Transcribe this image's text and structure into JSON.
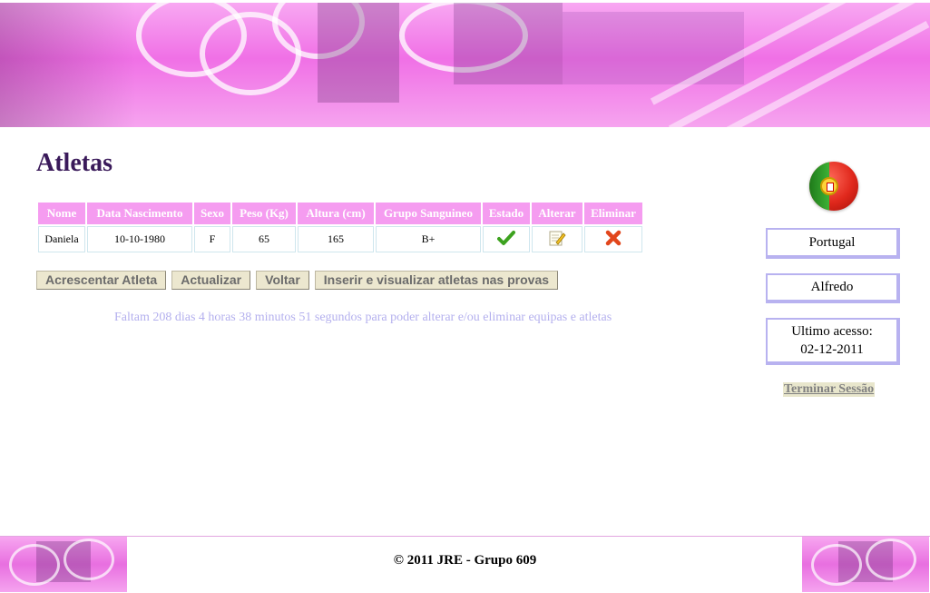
{
  "page": {
    "title": "Atletas"
  },
  "table": {
    "headers": [
      "Nome",
      "Data Nascimento",
      "Sexo",
      "Peso (Kg)",
      "Altura (cm)",
      "Grupo Sanguineo",
      "Estado",
      "Alterar",
      "Eliminar"
    ],
    "rows": [
      {
        "nome": "Daniela",
        "data_nascimento": "10-10-1980",
        "sexo": "F",
        "peso": "65",
        "altura": "165",
        "grupo_sanguineo": "B+",
        "estado_icon": "checkmark-icon",
        "alterar_icon": "edit-icon",
        "eliminar_icon": "delete-icon"
      }
    ]
  },
  "buttons": {
    "add": "Acrescentar Atleta",
    "refresh": "Actualizar",
    "back": "Voltar",
    "insert": "Inserir e visualizar atletas nas provas"
  },
  "countdown": "Faltam 208 dias 4 horas 38 minutos 51 segundos para poder alterar e/ou eliminar equipas e atletas",
  "sidebar": {
    "flag_icon": "portugal-flag-icon",
    "country": "Portugal",
    "user": "Alfredo",
    "last_access_label": "Ultimo acesso:",
    "last_access_date": "02-12-2011",
    "logout": "Terminar Sessão"
  },
  "footer": {
    "text": "© 2011 JRE - Grupo 609"
  },
  "colors": {
    "header_pink": "#f070e6",
    "th_pink": "#f59cf0",
    "title": "#3a1a5a",
    "countdown": "#b4b0ee",
    "box_border": "#b8b2f0"
  }
}
